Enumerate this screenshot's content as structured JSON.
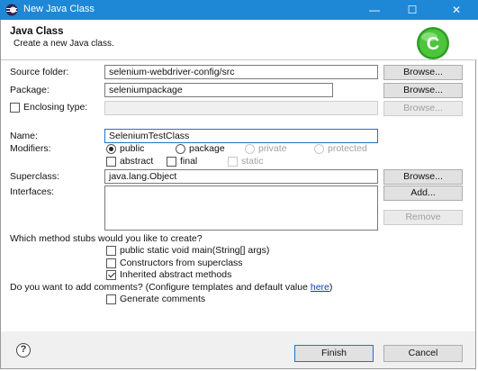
{
  "window": {
    "title": "New Java Class",
    "minimize_glyph": "—",
    "maximize_glyph": "☐",
    "close_glyph": "✕"
  },
  "header": {
    "title": "Java Class",
    "subtitle": "Create a new Java class.",
    "logo_icon": "new-class-wizard-icon",
    "logo_letter": "C",
    "logo_color": "#3cb62e"
  },
  "form": {
    "source_folder": {
      "label": "Source folder:",
      "value": "selenium-webdriver-config/src",
      "browse_label": "Browse..."
    },
    "package": {
      "label": "Package:",
      "value": "seleniumpackage",
      "browse_label": "Browse..."
    },
    "enclosing_type": {
      "label": "Enclosing type:",
      "value": "",
      "browse_label": "Browse...",
      "checked": false
    },
    "name": {
      "label": "Name:",
      "value": "SeleniumTestClass"
    },
    "modifiers": {
      "label": "Modifiers:",
      "access": [
        "public",
        "package",
        "private",
        "protected"
      ],
      "selected_access": "public",
      "options": [
        "abstract",
        "final",
        "static"
      ]
    },
    "superclass": {
      "label": "Superclass:",
      "value": "java.lang.Object",
      "browse_label": "Browse..."
    },
    "interfaces": {
      "label": "Interfaces:",
      "add_label": "Add...",
      "remove_label": "Remove"
    },
    "stubs": {
      "question": "Which method stubs would you like to create?",
      "items": [
        {
          "label": "public static void main(String[] args)",
          "checked": false
        },
        {
          "label": "Constructors from superclass",
          "checked": false
        },
        {
          "label": "Inherited abstract methods",
          "checked": true
        }
      ]
    },
    "comments": {
      "question": "Do you want to add comments? (Configure templates and default value ",
      "link": "here",
      "question_end": ")",
      "generate_label": "Generate comments",
      "checked": false
    }
  },
  "footer": {
    "help_glyph": "?",
    "finish_label": "Finish",
    "cancel_label": "Cancel"
  },
  "colors": {
    "titlebar": "#1e88d6",
    "focus_border": "#1c74c8"
  }
}
